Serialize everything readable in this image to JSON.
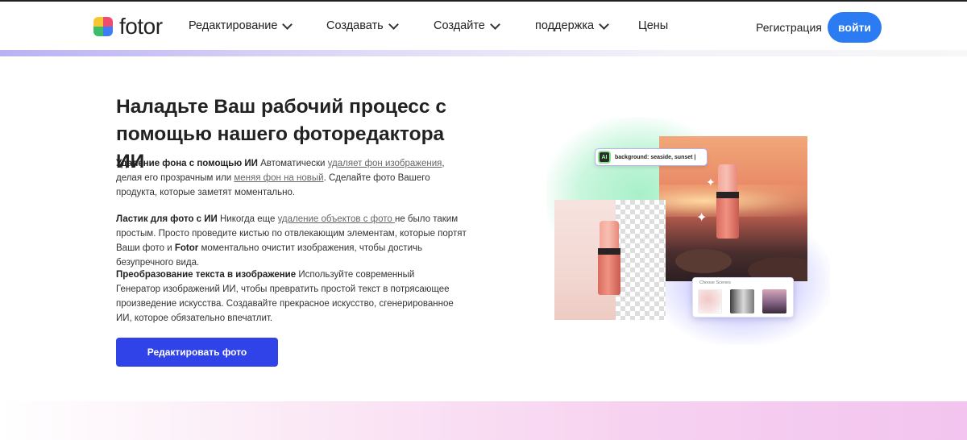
{
  "header": {
    "logo_text": "fotor",
    "nav": [
      {
        "label": "Редактирование",
        "has_dropdown": true
      },
      {
        "label": "Создавать",
        "has_dropdown": true
      },
      {
        "label": "Создайте",
        "has_dropdown": true
      },
      {
        "label": "поддержка",
        "has_dropdown": true
      },
      {
        "label": "Цены",
        "has_dropdown": false
      }
    ],
    "register_label": "Регистрация",
    "login_label": "войти"
  },
  "hero": {
    "title": "Наладьте Ваш рабочий процесс с помощью нашего фоторедактора ИИ",
    "p1": {
      "bold": "Удаление фона с помощью ИИ",
      "t1": " Автоматически ",
      "link1": "удаляет фон изображения",
      "t2": ", делая его прозрачным или ",
      "link2": "меняя фон на новый",
      "t3": ". Сделайте фото Вашего продукта, которые заметят моментально."
    },
    "p2": {
      "bold": "Ластик для фото с ИИ",
      "t1": " Никогда еще ",
      "link1": "удаление объектов с фото ",
      "t2": "не было таким простым. Просто проведите кистью по отвлекающим элементам, которые портят Ваши фото и ",
      "bold2": "Fotor",
      "t3": " моментально очистит изображения, чтобы достичь безупречного вида."
    },
    "p3": {
      "bold": "Преобразование текста в изображение",
      "t1": " Используйте современный Генератор изображений ИИ, чтобы превратить простой текст в потрясающее произведение искусства. Создавайте прекрасное искусство, сгенерированное ИИ, которое обязательно впечатлит."
    },
    "cta_label": "Редактировать фото"
  },
  "visual": {
    "ai_badge": "AI",
    "prompt": "background: seaside, sunset |",
    "scenes_title": "Choose Scenes"
  },
  "colors": {
    "brand_blue": "#2b7bf2",
    "cta_blue": "#2f43e8"
  }
}
